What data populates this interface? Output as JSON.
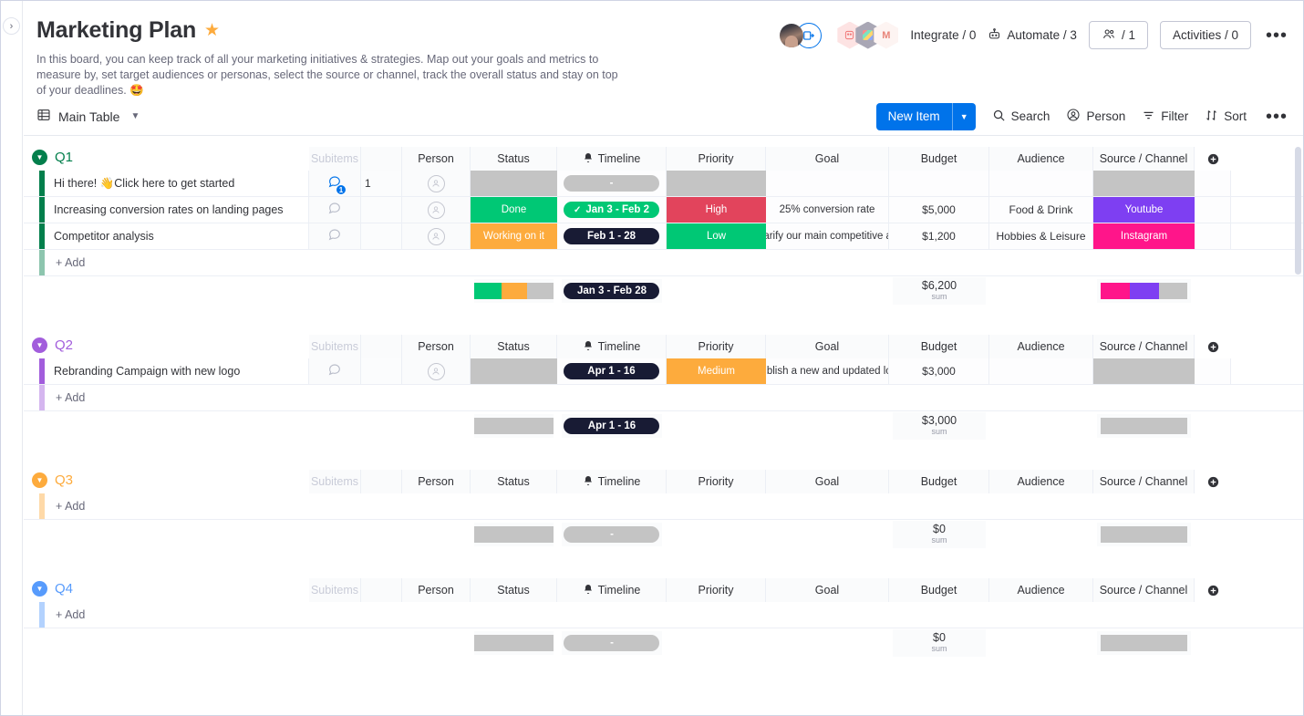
{
  "board": {
    "title": "Marketing Plan",
    "star_icon": "star-icon",
    "description": "In this board, you can keep track of all your marketing initiatives & strategies. Map out your goals and metrics to measure by, set target audiences or personas, select the source or channel, track the overall status and stay on top of your deadlines. 🤩"
  },
  "header_actions": {
    "integrate": "Integrate / 0",
    "automate": "Automate / 3",
    "members": "/ 1",
    "activities": "Activities / 0",
    "more": "•••"
  },
  "view_bar": {
    "view_name": "Main Table",
    "new_item": "New Item",
    "search": "Search",
    "person": "Person",
    "filter": "Filter",
    "sort": "Sort",
    "more": "•••"
  },
  "columns": {
    "subitems": "Subitems",
    "person": "Person",
    "status": "Status",
    "timeline": "Timeline",
    "priority": "Priority",
    "goal": "Goal",
    "budget": "Budget",
    "audience": "Audience",
    "source": "Source / Channel",
    "add": "+"
  },
  "add_row_label": "+ Add",
  "sum_label": "sum",
  "colors": {
    "green": "#00c875",
    "orange": "#fdab3d",
    "dark": "#181b34",
    "red": "#e2445c",
    "purple": "#7e3ff2",
    "pink": "#ff158a",
    "gray": "#c4c4c4",
    "q1": "#037f4c",
    "q2": "#a25ddc",
    "q3": "#fdab3d",
    "q4": "#579bfc",
    "blue": "#0073ea"
  },
  "groups": [
    {
      "name": "Q1",
      "color": "#037f4c",
      "items": [
        {
          "name": "Hi there! 👋Click here to get started",
          "chat_count": "1",
          "subitem_count": "1",
          "status": {
            "label": "",
            "color": "#c4c4c4"
          },
          "timeline": {
            "label": "-",
            "color": "#c4c4c4",
            "done": false
          },
          "priority": {
            "label": "",
            "color": "#c4c4c4"
          },
          "goal": "",
          "budget": "",
          "audience": "",
          "source": {
            "label": "",
            "color": "#c4c4c4"
          }
        },
        {
          "name": "Increasing conversion rates on landing pages",
          "chat_count": "",
          "subitem_count": "",
          "status": {
            "label": "Done",
            "color": "#00c875"
          },
          "timeline": {
            "label": "Jan 3 - Feb 2",
            "color": "#00c875",
            "done": true
          },
          "priority": {
            "label": "High",
            "color": "#e2445c"
          },
          "goal": "25% conversion rate",
          "budget": "$5,000",
          "audience": "Food & Drink",
          "source": {
            "label": "Youtube",
            "color": "#7e3ff2"
          }
        },
        {
          "name": "Competitor analysis",
          "chat_count": "",
          "subitem_count": "",
          "status": {
            "label": "Working on it",
            "color": "#fdab3d"
          },
          "timeline": {
            "label": "Feb 1 - 28",
            "color": "#181b34",
            "done": false
          },
          "priority": {
            "label": "Low",
            "color": "#00c875"
          },
          "goal": "Clarify our main competitive a...",
          "budget": "$1,200",
          "audience": "Hobbies & Leisure",
          "source": {
            "label": "Instagram",
            "color": "#ff158a"
          }
        }
      ],
      "summary": {
        "status_segments": [
          {
            "color": "#00c875",
            "pct": 34
          },
          {
            "color": "#fdab3d",
            "pct": 33
          },
          {
            "color": "#c4c4c4",
            "pct": 33
          }
        ],
        "timeline": {
          "label": "Jan 3 - Feb 28",
          "color": "#181b34"
        },
        "budget": "$6,200",
        "source_segments": [
          {
            "color": "#ff158a",
            "pct": 34
          },
          {
            "color": "#7e3ff2",
            "pct": 33
          },
          {
            "color": "#c4c4c4",
            "pct": 33
          }
        ]
      }
    },
    {
      "name": "Q2",
      "color": "#a25ddc",
      "items": [
        {
          "name": "Rebranding Campaign with new logo",
          "chat_count": "",
          "subitem_count": "",
          "status": {
            "label": "",
            "color": "#c4c4c4"
          },
          "timeline": {
            "label": "Apr 1 - 16",
            "color": "#181b34",
            "done": false
          },
          "priority": {
            "label": "Medium",
            "color": "#fdab3d"
          },
          "goal": "Publish a new and updated lo...",
          "budget": "$3,000",
          "audience": "",
          "source": {
            "label": "",
            "color": "#c4c4c4"
          }
        }
      ],
      "summary": {
        "status_segments": [
          {
            "color": "#c4c4c4",
            "pct": 100
          }
        ],
        "timeline": {
          "label": "Apr 1 - 16",
          "color": "#181b34"
        },
        "budget": "$3,000",
        "source_segments": [
          {
            "color": "#c4c4c4",
            "pct": 100
          }
        ]
      }
    },
    {
      "name": "Q3",
      "color": "#fdab3d",
      "items": [],
      "summary": {
        "status_segments": [
          {
            "color": "#c4c4c4",
            "pct": 100
          }
        ],
        "timeline": {
          "label": "-",
          "color": "#c4c4c4"
        },
        "budget": "$0",
        "source_segments": [
          {
            "color": "#c4c4c4",
            "pct": 100
          }
        ]
      }
    },
    {
      "name": "Q4",
      "color": "#579bfc",
      "items": [],
      "summary": {
        "status_segments": [
          {
            "color": "#c4c4c4",
            "pct": 100
          }
        ],
        "timeline": {
          "label": "-",
          "color": "#c4c4c4"
        },
        "budget": "$0",
        "source_segments": [
          {
            "color": "#c4c4c4",
            "pct": 100
          }
        ]
      }
    }
  ]
}
